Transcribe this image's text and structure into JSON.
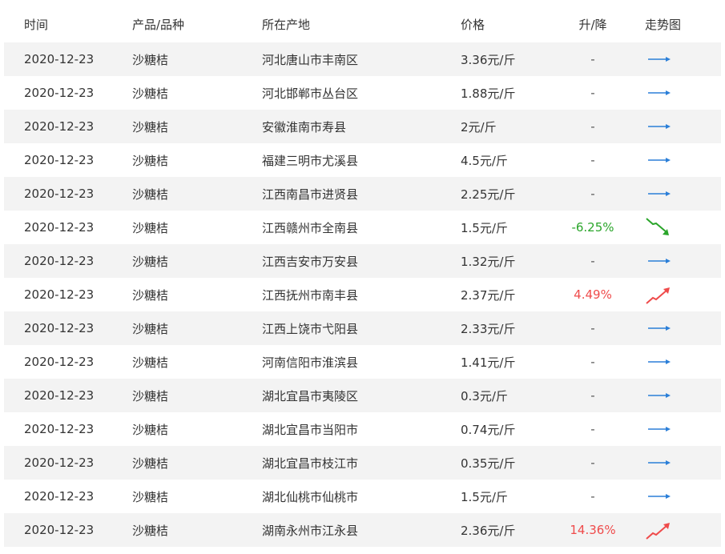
{
  "columns": {
    "date": "时间",
    "product": "产品/品种",
    "origin": "所在产地",
    "price": "价格",
    "change": "升/降",
    "trend": "走势图"
  },
  "rows": [
    {
      "date": "2020-12-23",
      "product": "沙糖桔",
      "origin": "河北唐山市丰南区",
      "price": "3.36元/斤",
      "change": "-",
      "trend": "flat"
    },
    {
      "date": "2020-12-23",
      "product": "沙糖桔",
      "origin": "河北邯郸市丛台区",
      "price": "1.88元/斤",
      "change": "-",
      "trend": "flat"
    },
    {
      "date": "2020-12-23",
      "product": "沙糖桔",
      "origin": "安徽淮南市寿县",
      "price": "2元/斤",
      "change": "-",
      "trend": "flat"
    },
    {
      "date": "2020-12-23",
      "product": "沙糖桔",
      "origin": "福建三明市尤溪县",
      "price": "4.5元/斤",
      "change": "-",
      "trend": "flat"
    },
    {
      "date": "2020-12-23",
      "product": "沙糖桔",
      "origin": "江西南昌市进贤县",
      "price": "2.25元/斤",
      "change": "-",
      "trend": "flat"
    },
    {
      "date": "2020-12-23",
      "product": "沙糖桔",
      "origin": "江西赣州市全南县",
      "price": "1.5元/斤",
      "change": "-6.25%",
      "trend": "down"
    },
    {
      "date": "2020-12-23",
      "product": "沙糖桔",
      "origin": "江西吉安市万安县",
      "price": "1.32元/斤",
      "change": "-",
      "trend": "flat"
    },
    {
      "date": "2020-12-23",
      "product": "沙糖桔",
      "origin": "江西抚州市南丰县",
      "price": "2.37元/斤",
      "change": "4.49%",
      "trend": "up"
    },
    {
      "date": "2020-12-23",
      "product": "沙糖桔",
      "origin": "江西上饶市弋阳县",
      "price": "2.33元/斤",
      "change": "-",
      "trend": "flat"
    },
    {
      "date": "2020-12-23",
      "product": "沙糖桔",
      "origin": "河南信阳市淮滨县",
      "price": "1.41元/斤",
      "change": "-",
      "trend": "flat"
    },
    {
      "date": "2020-12-23",
      "product": "沙糖桔",
      "origin": "湖北宜昌市夷陵区",
      "price": "0.3元/斤",
      "change": "-",
      "trend": "flat"
    },
    {
      "date": "2020-12-23",
      "product": "沙糖桔",
      "origin": "湖北宜昌市当阳市",
      "price": "0.74元/斤",
      "change": "-",
      "trend": "flat"
    },
    {
      "date": "2020-12-23",
      "product": "沙糖桔",
      "origin": "湖北宜昌市枝江市",
      "price": "0.35元/斤",
      "change": "-",
      "trend": "flat"
    },
    {
      "date": "2020-12-23",
      "product": "沙糖桔",
      "origin": "湖北仙桃市仙桃市",
      "price": "1.5元/斤",
      "change": "-",
      "trend": "flat"
    },
    {
      "date": "2020-12-23",
      "product": "沙糖桔",
      "origin": "湖南永州市江永县",
      "price": "2.36元/斤",
      "change": "14.36%",
      "trend": "up"
    }
  ],
  "colors": {
    "up": "#ef4b4b",
    "down": "#2aa52a",
    "flat_arrow": "#2b7fd8",
    "stripe": "#f3f3f3"
  }
}
